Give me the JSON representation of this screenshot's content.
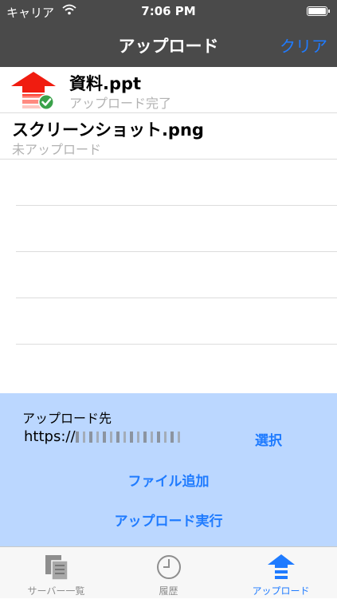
{
  "status_bar": {
    "carrier": "キャリア",
    "time": "7:06 PM"
  },
  "nav": {
    "title": "アップロード",
    "clear_label": "クリア"
  },
  "files": [
    {
      "name": "資料.ppt",
      "status": "アップロード完了"
    },
    {
      "name": "スクリーンショット.png",
      "status": "未アップロード"
    }
  ],
  "panel": {
    "destination_label": "アップロード先",
    "url_prefix": "https://",
    "select_label": "選択",
    "add_file_label": "ファイル追加",
    "execute_label": "アップロード実行"
  },
  "tabs": [
    {
      "label": "サーバー一覧",
      "icon": "server-list-icon"
    },
    {
      "label": "履歴",
      "icon": "clock-icon"
    },
    {
      "label": "アップロード",
      "icon": "upload-arrow-icon",
      "active": true
    }
  ],
  "colors": {
    "accent": "#1f7bff",
    "panel": "#bbd7ff",
    "bar": "#4a4a4a"
  }
}
